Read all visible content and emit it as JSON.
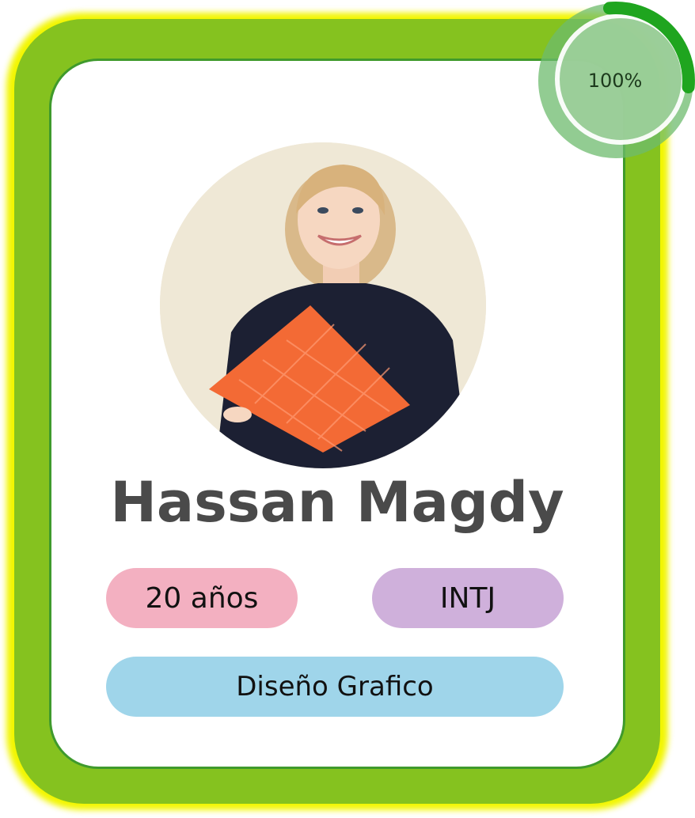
{
  "profile": {
    "name": "Hassan Magdy",
    "age_label": "20 años",
    "personality_type": "INTJ",
    "career": "Diseño Grafico"
  },
  "progress": {
    "label": "100%",
    "value": 1.0
  },
  "colors": {
    "frame_outer": "#85c21f",
    "frame_halo": "#f2f600",
    "card_border": "#3f9a2c",
    "name_text": "#4a4a4a",
    "age_pill": "#f3b0c1",
    "type_pill": "#cfb0db",
    "career_pill": "#9fd5ea",
    "ring_fill": "#6dbb6d",
    "ring_arc": "#1fa51f"
  },
  "icons": {
    "avatar": "profile-photo"
  }
}
